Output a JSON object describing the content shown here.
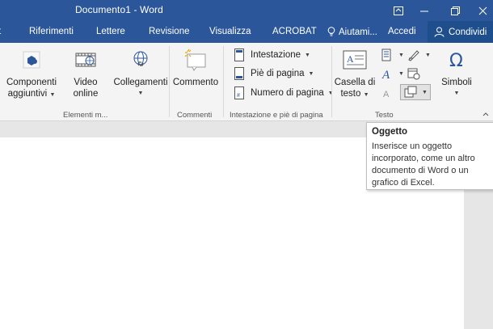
{
  "window": {
    "title": "Documento1 - Word",
    "buttons": {
      "ribbon_options": "ribbon-display-options",
      "restore": "restore",
      "close": "close"
    }
  },
  "tabs": [
    {
      "label": "t"
    },
    {
      "label": "Riferimenti"
    },
    {
      "label": "Lettere"
    },
    {
      "label": "Revisione"
    },
    {
      "label": "Visualizza"
    },
    {
      "label": "ACROBAT"
    }
  ],
  "tell_me": {
    "label": "Aiutami..."
  },
  "account": {
    "label": "Accedi"
  },
  "share": {
    "label": "Condividi"
  },
  "ribbon": {
    "groups": {
      "elementi": {
        "label": "Elementi m...",
        "componenti": {
          "line1": "Componenti",
          "line2": "aggiuntivi"
        },
        "video": {
          "line1": "Video",
          "line2": "online"
        },
        "collegamenti": {
          "line1": "Collegamenti"
        }
      },
      "commenti": {
        "label": "Commenti",
        "commento": {
          "label": "Commento"
        }
      },
      "intestazione": {
        "label": "Intestazione e piè di pagina",
        "intestazione": "Intestazione",
        "pie": "Piè di pagina",
        "numero": "Numero di pagina"
      },
      "testo": {
        "label": "Testo",
        "casella": {
          "line1": "Casella di",
          "line2": "testo"
        },
        "simboli": {
          "label": "Simboli"
        }
      }
    }
  },
  "tooltip": {
    "title": "Oggetto",
    "body": "Inserisce un oggetto incorporato, come un altro documento di Word o un grafico di Excel."
  },
  "colors": {
    "brand": "#2b579a",
    "share_bg": "#1f4e8c",
    "ribbon_bg": "#f4f4f4"
  }
}
